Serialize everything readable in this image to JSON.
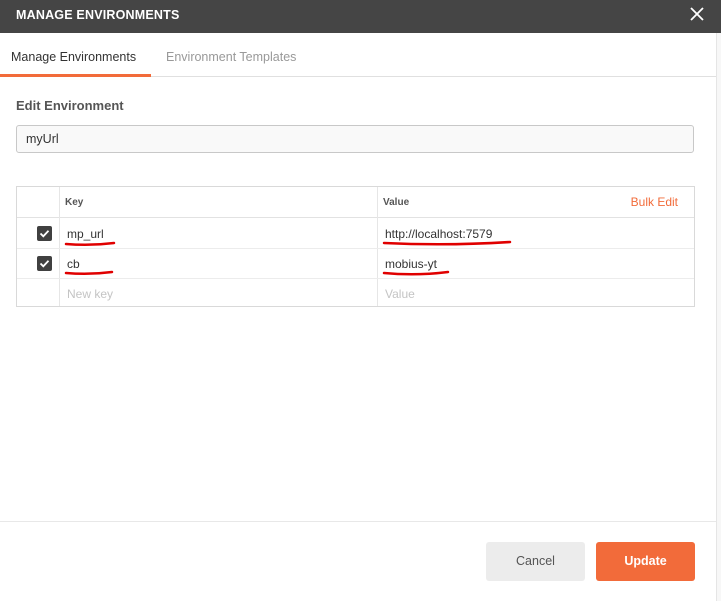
{
  "modal": {
    "title": "MANAGE ENVIRONMENTS"
  },
  "tabs": [
    {
      "label": "Manage Environments",
      "active": true
    },
    {
      "label": "Environment Templates",
      "active": false
    }
  ],
  "edit": {
    "section_title": "Edit Environment",
    "name_value": "myUrl"
  },
  "table": {
    "key_header": "Key",
    "value_header": "Value",
    "bulk_edit_label": "Bulk Edit",
    "rows": [
      {
        "checked": true,
        "key": "mp_url",
        "value": "http://localhost:7579"
      },
      {
        "checked": true,
        "key": "cb",
        "value": "mobius-yt"
      }
    ],
    "new_row": {
      "key_placeholder": "New key",
      "value_placeholder": "Value"
    }
  },
  "footer": {
    "cancel_label": "Cancel",
    "update_label": "Update"
  },
  "colors": {
    "accent": "#f26b3a",
    "titlebar": "#454545",
    "annotation": "#e00000"
  }
}
